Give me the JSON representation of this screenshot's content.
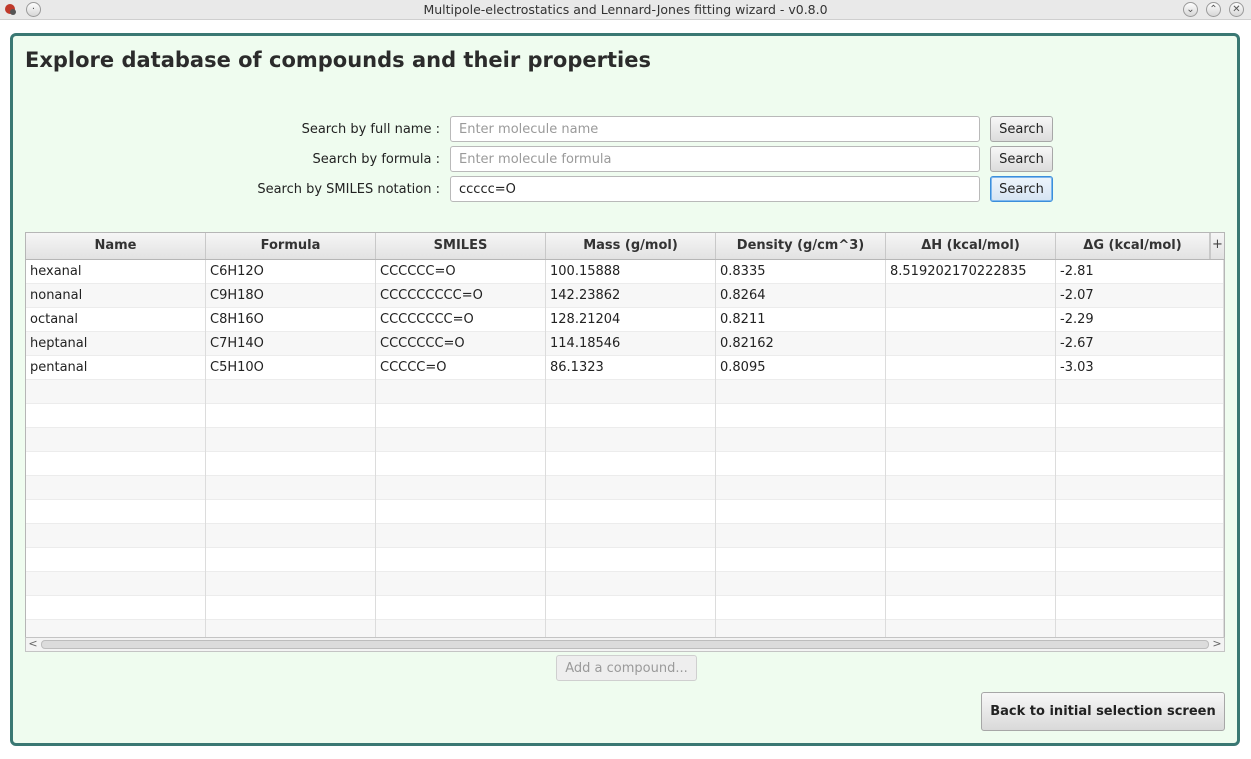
{
  "window": {
    "title": "Multipole-electrostatics and Lennard-Jones fitting wizard - v0.8.0",
    "buttons": {
      "minimize": "⌄",
      "maximize": "⌃",
      "close": "✕"
    }
  },
  "heading": "Explore database of compounds and their properties",
  "search": {
    "name": {
      "label": "Search by full name :",
      "placeholder": "Enter molecule name",
      "value": "",
      "button": "Search"
    },
    "formula": {
      "label": "Search by formula :",
      "placeholder": "Enter molecule formula",
      "value": "",
      "button": "Search"
    },
    "smiles": {
      "label": "Search by SMILES notation :",
      "placeholder": "",
      "value": "ccccc=O",
      "button": "Search"
    }
  },
  "table": {
    "columns": [
      "Name",
      "Formula",
      "SMILES",
      "Mass (g/mol)",
      "Density (g/cm^3)",
      "ΔH (kcal/mol)",
      "ΔG (kcal/mol)"
    ],
    "plus_label": "+",
    "rows": [
      [
        "hexanal",
        "C6H12O",
        "CCCCCC=O",
        "100.15888",
        "0.8335",
        "8.519202170222835",
        "-2.81"
      ],
      [
        "nonanal",
        "C9H18O",
        "CCCCCCCCC=O",
        "142.23862",
        "0.8264",
        "",
        "-2.07"
      ],
      [
        "octanal",
        "C8H16O",
        "CCCCCCCC=O",
        "128.21204",
        "0.8211",
        "",
        "-2.29"
      ],
      [
        "heptanal",
        "C7H14O",
        "CCCCCCC=O",
        "114.18546",
        "0.82162",
        "",
        "-2.67"
      ],
      [
        "pentanal",
        "C5H10O",
        "CCCCC=O",
        "86.1323",
        "0.8095",
        "",
        "-3.03"
      ]
    ],
    "empty_rows": 11
  },
  "scrollbar": {
    "left": "<",
    "right": ">"
  },
  "add_button": "Add a compound...",
  "back_button": "Back to initial selection screen",
  "colors": {
    "panel_bg": "#effcef",
    "panel_border": "#3a7873",
    "focus": "#3b8edb"
  }
}
